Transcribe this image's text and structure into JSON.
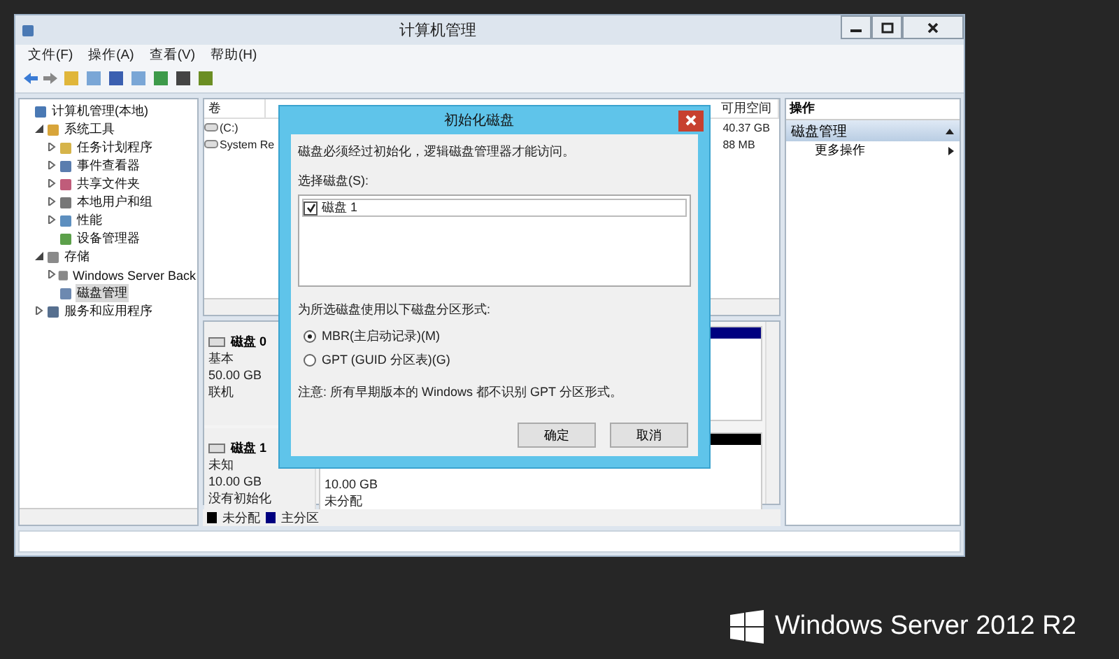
{
  "window": {
    "title": "计算机管理"
  },
  "menu": [
    "文件(F)",
    "操作(A)",
    "查看(V)",
    "帮助(H)"
  ],
  "tree": [
    {
      "label": "计算机管理(本地)",
      "selected": false,
      "children": [
        {
          "label": "系统工具",
          "expanded": true,
          "selected": false,
          "children": [
            {
              "label": "任务计划程序",
              "expanded": false,
              "selected": false
            },
            {
              "label": "事件查看器",
              "expanded": false,
              "selected": false
            },
            {
              "label": "共享文件夹",
              "expanded": false,
              "selected": false
            },
            {
              "label": "本地用户和组",
              "expanded": false,
              "selected": false
            },
            {
              "label": "性能",
              "expanded": false,
              "selected": false
            },
            {
              "label": "设备管理器",
              "selected": false
            }
          ]
        },
        {
          "label": "存储",
          "expanded": true,
          "selected": false,
          "children": [
            {
              "label": "Windows Server Back",
              "expanded": false,
              "selected": false
            },
            {
              "label": "磁盘管理",
              "selected": true
            }
          ]
        },
        {
          "label": "服务和应用程序",
          "expanded": false,
          "selected": false
        }
      ]
    }
  ],
  "volumes": {
    "columns": [
      "卷",
      "可用空间"
    ],
    "rows": [
      {
        "volume": "(C:)",
        "free_space": "40.37 GB"
      },
      {
        "volume": "System Re",
        "free_space": "88 MB"
      }
    ]
  },
  "disks": [
    {
      "name": "磁盘 0",
      "type": "基本",
      "size": "50.00 GB",
      "status": "联机",
      "partitions": [
        {
          "kind": "primary"
        }
      ]
    },
    {
      "name": "磁盘 1",
      "type": "未知",
      "size": "10.00 GB",
      "status": "没有初始化",
      "partitions": [
        {
          "kind": "unallocated",
          "size": "10.00 GB",
          "label": "未分配"
        }
      ]
    }
  ],
  "legend": [
    {
      "label": "未分配",
      "color": "#000000"
    },
    {
      "label": "主分区",
      "color": "#000080"
    }
  ],
  "actions": {
    "title": "操作",
    "section": "磁盘管理",
    "items": [
      {
        "label": "更多操作"
      }
    ]
  },
  "dialog": {
    "title": "初始化磁盘",
    "message": "磁盘必须经过初始化，逻辑磁盘管理器才能访问。",
    "list_label": "选择磁盘(S):",
    "disks": [
      {
        "label": "磁盘 1",
        "checked": true
      }
    ],
    "style_label": "为所选磁盘使用以下磁盘分区形式:",
    "options": [
      {
        "label": "MBR(主启动记录)(M)",
        "selected": true
      },
      {
        "label": "GPT (GUID 分区表)(G)",
        "selected": false
      }
    ],
    "note": "注意: 所有早期版本的 Windows 都不识别 GPT 分区形式。",
    "buttons": [
      "确定",
      "取消"
    ]
  },
  "branding": {
    "text": "Windows Server 2012 R2"
  }
}
